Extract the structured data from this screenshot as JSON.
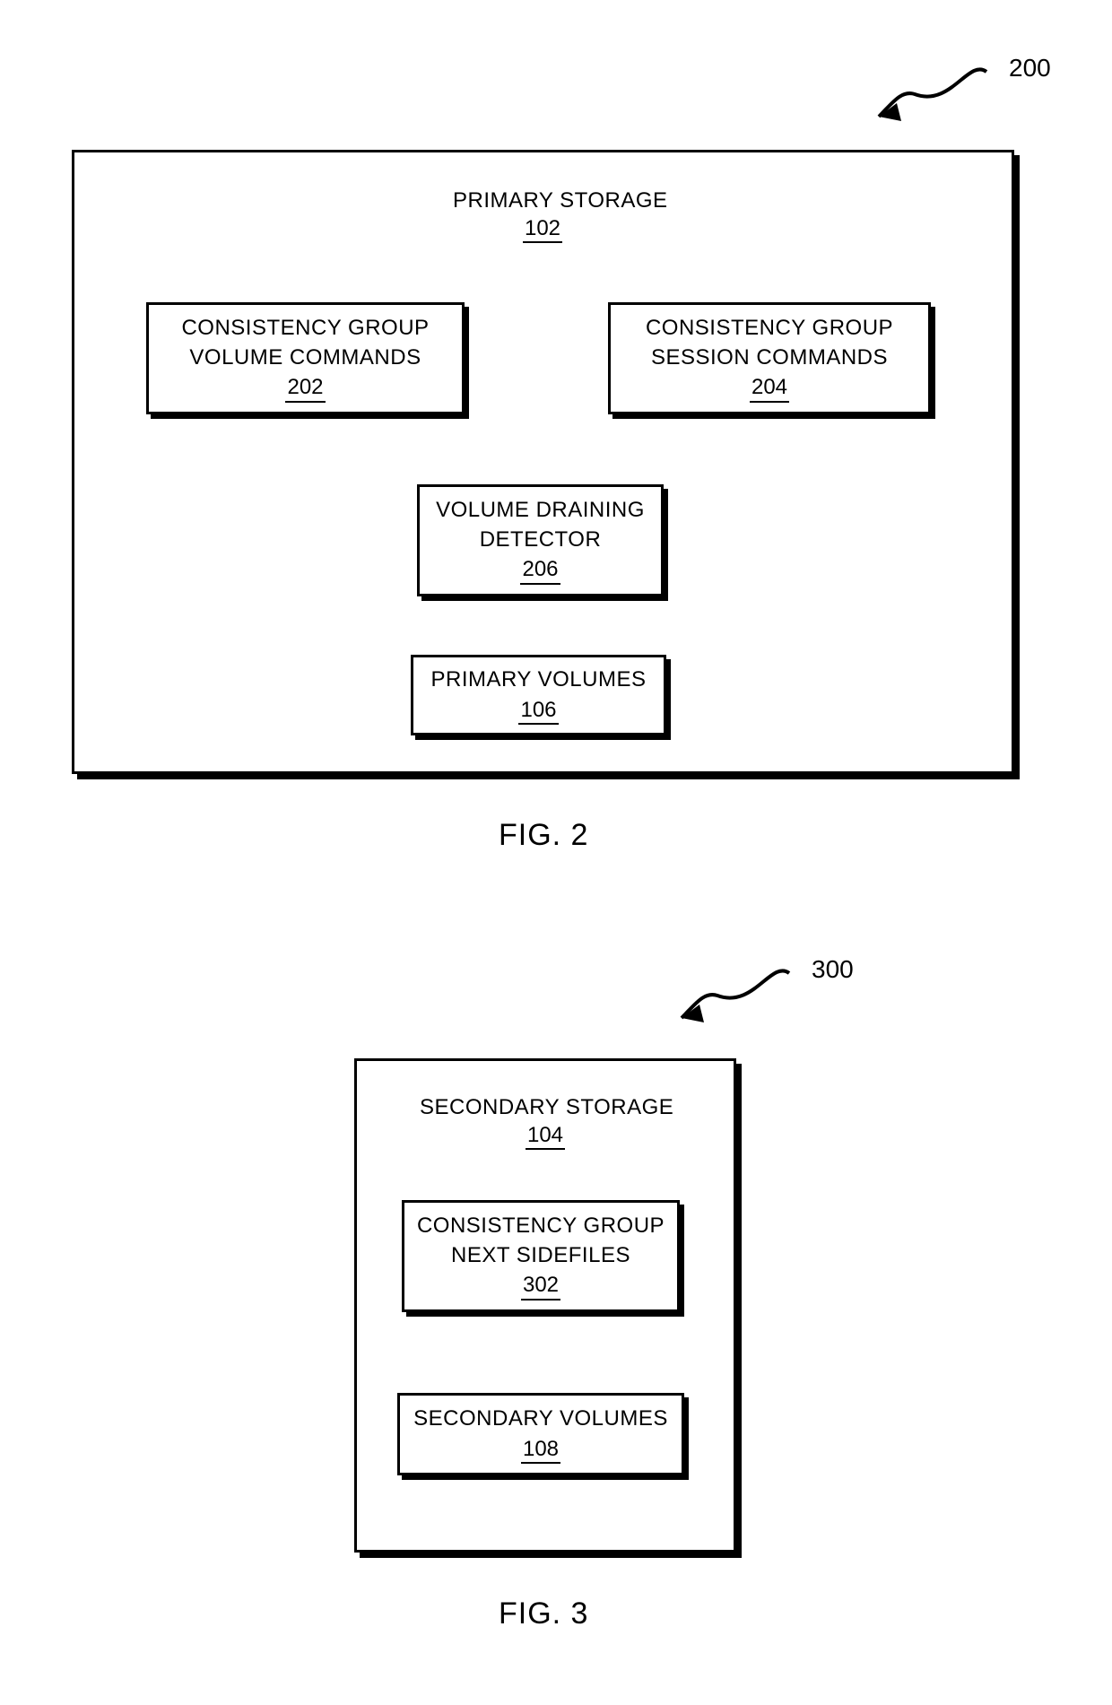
{
  "fig2": {
    "ref": "200",
    "outer": {
      "title": "PRIMARY STORAGE",
      "num": "102"
    },
    "boxes": {
      "volcmd": {
        "title": "CONSISTENCY GROUP\nVOLUME COMMANDS",
        "num": "202"
      },
      "sesscmd": {
        "title": "CONSISTENCY GROUP\nSESSION COMMANDS",
        "num": "204"
      },
      "detector": {
        "title": "VOLUME DRAINING\nDETECTOR",
        "num": "206"
      },
      "primvol": {
        "title": "PRIMARY VOLUMES",
        "num": "106"
      }
    },
    "caption": "FIG. 2"
  },
  "fig3": {
    "ref": "300",
    "outer": {
      "title": "SECONDARY STORAGE",
      "num": "104"
    },
    "boxes": {
      "sidefiles": {
        "title": "CONSISTENCY GROUP\nNEXT SIDEFILES",
        "num": "302"
      },
      "secvol": {
        "title": "SECONDARY VOLUMES",
        "num": "108"
      }
    },
    "caption": "FIG. 3"
  }
}
